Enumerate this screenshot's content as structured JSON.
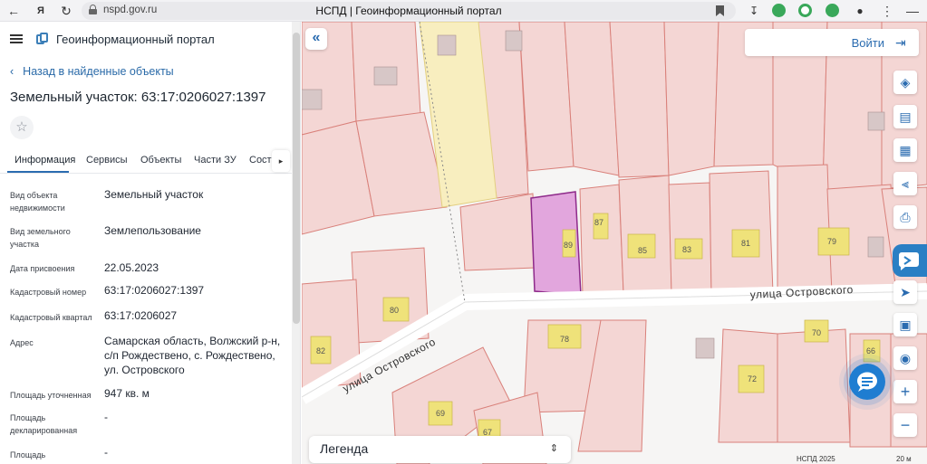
{
  "browser": {
    "url": "nspd.gov.ru",
    "tab_title": "НСПД | Геоинформационный портал"
  },
  "app": {
    "title": "Геоинформационный портал"
  },
  "panel": {
    "back_link": "Назад в найденные объекты",
    "object_title": "Земельный участок: 63:17:0206027:1397",
    "tabs": [
      "Информация",
      "Сервисы",
      "Объекты",
      "Части ЗУ",
      "Соста"
    ],
    "active_tab": "Информация",
    "rows": [
      {
        "label": "Вид объекта недвижимости",
        "value": "Земельный участок"
      },
      {
        "label": "Вид земельного участка",
        "value": "Землепользование"
      },
      {
        "label": "Дата присвоения",
        "value": "22.05.2023"
      },
      {
        "label": "Кадастровый номер",
        "value": "63:17:0206027:1397"
      },
      {
        "label": "Кадастровый квартал",
        "value": "63:17:0206027"
      },
      {
        "label": "Адрес",
        "value": "Самарская область, Волжский р-н, с/п Рождествено, с. Рождествено, ул. Островского"
      },
      {
        "label": "Площадь уточненная",
        "value": "947 кв. м"
      },
      {
        "label": "Площадь декларированная",
        "value": "-"
      },
      {
        "label": "Площадь",
        "value": "-"
      }
    ]
  },
  "map": {
    "login_label": "Войти",
    "legend_label": "Легенда",
    "streets": [
      "улица Островского",
      "улица Островского"
    ],
    "house_numbers": [
      "89",
      "87",
      "85",
      "83",
      "81",
      "79",
      "80",
      "82",
      "78",
      "70",
      "66",
      "72",
      "69",
      "67"
    ],
    "footer_copyright": "НСПД 2025",
    "footer_scale": "20 м",
    "highlight_color": "#e2a6dd",
    "highlight_stroke": "#8e2a8a",
    "parcel_stroke": "#d9807a",
    "parcel_fill": "#f4d6d4"
  },
  "icons": {
    "toolbar": [
      "layers-icon",
      "ruler-icon",
      "select-area-icon",
      "share-icon",
      "print-icon"
    ],
    "toolbar2": [
      "navigate-icon",
      "map-preview-icon",
      "location-icon",
      "zoom-in-icon",
      "zoom-out-icon"
    ]
  }
}
